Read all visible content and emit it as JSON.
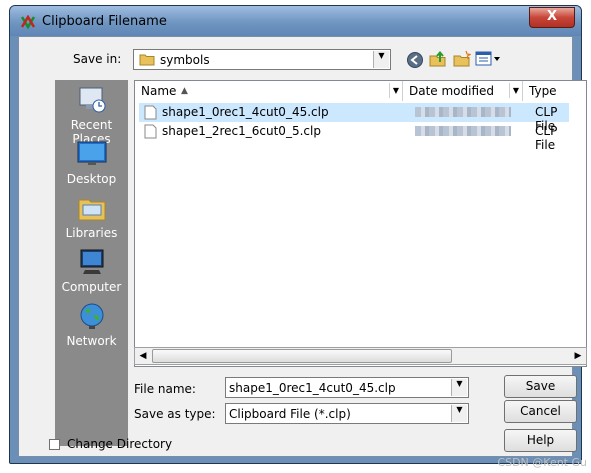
{
  "window": {
    "title": "Clipboard Filename",
    "close_label": "X"
  },
  "toolbar": {
    "save_in_label": "Save in:",
    "save_in_value": "symbols"
  },
  "places": [
    {
      "label": "Recent Places",
      "icon": "recent-places-icon"
    },
    {
      "label": "Desktop",
      "icon": "desktop-icon"
    },
    {
      "label": "Libraries",
      "icon": "libraries-icon"
    },
    {
      "label": "Computer",
      "icon": "computer-icon"
    },
    {
      "label": "Network",
      "icon": "network-icon"
    }
  ],
  "file_list": {
    "columns": [
      "Name",
      "Date modified",
      "Type"
    ],
    "rows": [
      {
        "name": "shape1_0rec1_4cut0_45.clp",
        "type": "CLP File",
        "selected": true
      },
      {
        "name": "shape1_2rec1_6cut0_5.clp",
        "type": "CLP File",
        "selected": false
      }
    ]
  },
  "form": {
    "file_name_label": "File name:",
    "file_name_value": "shape1_0rec1_4cut0_45.clp",
    "save_as_type_label": "Save as type:",
    "save_as_type_value": "Clipboard File (*.clp)"
  },
  "buttons": {
    "save": "Save",
    "cancel": "Cancel",
    "help": "Help"
  },
  "change_directory_label": "Change Directory",
  "watermark": "CSDN @Kent Gu",
  "colors": {
    "selection": "#cce8ff",
    "title_gradient": "#6f95c1",
    "sidebar": "#8a8a8a"
  }
}
